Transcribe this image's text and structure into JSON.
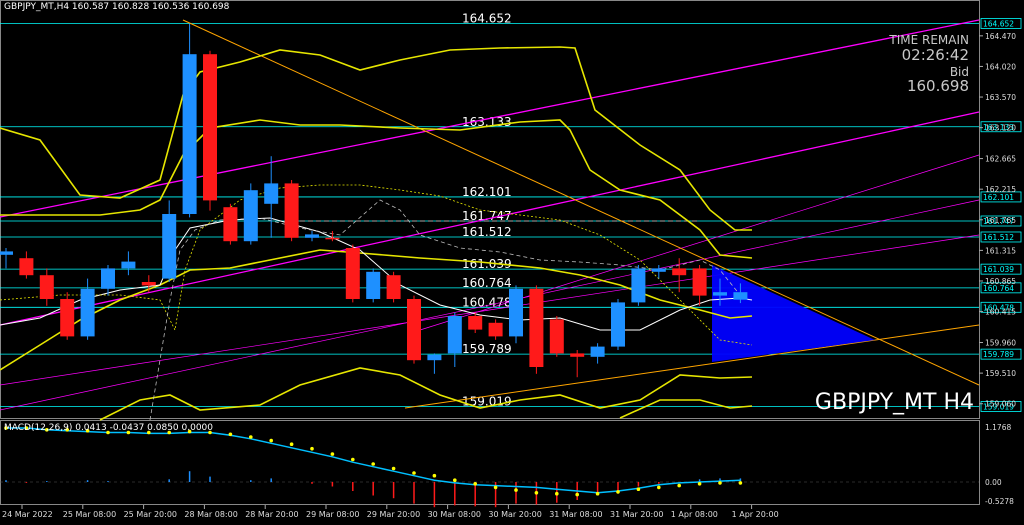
{
  "chart_header": "GBPJPY_MT,H4  160.587 160.828 160.536 160.698",
  "time_remain": {
    "label": "TIME REMAIN",
    "value": "02:26:42",
    "bid_label": "Bid",
    "bid_value": "160.698"
  },
  "symbol_label": "GBPJPY_MT H4",
  "macd_header": "MACD(12,26,9) 0.0413 -0.0437 0.0850 0.0000",
  "colors": {
    "bull": "#1e90ff",
    "bear": "#ff1a1a",
    "bands": "#e6e600",
    "trend": "#ffa500",
    "channel": "#ff00ff",
    "level": "#00ffff",
    "signal": "#ffff00",
    "macd_line": "#00bfff",
    "triangle": "#0000ff"
  },
  "chart_data": {
    "type": "candlestick",
    "price_axis_ticks": [
      "164.470",
      "164.020",
      "163.570",
      "163.120",
      "162.665",
      "162.215",
      "161.765",
      "161.315",
      "160.865",
      "160.415",
      "159.960",
      "159.510",
      "159.060"
    ],
    "price_tags": [
      "164.652",
      "163.133",
      "162.101",
      "161.747",
      "161.512",
      "161.039",
      "160.764",
      "160.478",
      "159.789",
      "159.019"
    ],
    "level_labels": [
      "164.652",
      "163.133",
      "162.101",
      "161.747",
      "161.512",
      "161.039",
      "160.764",
      "160.478",
      "159.789",
      "159.019"
    ],
    "time_labels": [
      "24 Mar 2022",
      "25 Mar 08:00",
      "25 Mar 20:00",
      "28 Mar 08:00",
      "28 Mar 20:00",
      "29 Mar 08:00",
      "29 Mar 20:00",
      "30 Mar 08:00",
      "30 Mar 20:00",
      "31 Mar 08:00",
      "31 Mar 20:00",
      "1 Apr 08:00",
      "1 Apr 20:00"
    ],
    "macd_axis_ticks": [
      "1.1768",
      "0.00",
      "-0.5278"
    ],
    "candles": [
      {
        "o": 161.25,
        "h": 161.35,
        "l": 161.05,
        "c": 161.3
      },
      {
        "o": 161.2,
        "h": 161.3,
        "l": 160.9,
        "c": 160.95
      },
      {
        "o": 160.95,
        "h": 161.05,
        "l": 160.5,
        "c": 160.6
      },
      {
        "o": 160.6,
        "h": 160.7,
        "l": 160.0,
        "c": 160.05
      },
      {
        "o": 160.05,
        "h": 160.9,
        "l": 160.0,
        "c": 160.75
      },
      {
        "o": 160.75,
        "h": 161.1,
        "l": 160.65,
        "c": 161.05
      },
      {
        "o": 161.05,
        "h": 161.3,
        "l": 160.95,
        "c": 161.15
      },
      {
        "o": 160.85,
        "h": 160.95,
        "l": 160.7,
        "c": 160.8
      },
      {
        "o": 160.9,
        "h": 162.05,
        "l": 160.85,
        "c": 161.85
      },
      {
        "o": 161.85,
        "h": 164.65,
        "l": 161.8,
        "c": 164.2
      },
      {
        "o": 164.2,
        "h": 164.25,
        "l": 161.9,
        "c": 162.05
      },
      {
        "o": 161.95,
        "h": 162.0,
        "l": 161.4,
        "c": 161.45
      },
      {
        "o": 161.45,
        "h": 162.3,
        "l": 161.4,
        "c": 162.2
      },
      {
        "o": 162.0,
        "h": 162.7,
        "l": 161.5,
        "c": 162.3
      },
      {
        "o": 162.3,
        "h": 162.35,
        "l": 161.45,
        "c": 161.5
      },
      {
        "o": 161.5,
        "h": 161.6,
        "l": 161.45,
        "c": 161.55
      },
      {
        "o": 161.5,
        "h": 161.6,
        "l": 161.45,
        "c": 161.48
      },
      {
        "o": 161.35,
        "h": 161.4,
        "l": 160.55,
        "c": 160.6
      },
      {
        "o": 160.6,
        "h": 161.05,
        "l": 160.55,
        "c": 161.0
      },
      {
        "o": 160.95,
        "h": 161.0,
        "l": 160.55,
        "c": 160.6
      },
      {
        "o": 160.6,
        "h": 160.65,
        "l": 159.65,
        "c": 159.7
      },
      {
        "o": 159.7,
        "h": 159.8,
        "l": 159.5,
        "c": 159.78
      },
      {
        "o": 159.8,
        "h": 160.4,
        "l": 159.6,
        "c": 160.35
      },
      {
        "o": 160.35,
        "h": 160.4,
        "l": 160.1,
        "c": 160.15
      },
      {
        "o": 160.25,
        "h": 160.3,
        "l": 160.0,
        "c": 160.05
      },
      {
        "o": 160.05,
        "h": 160.8,
        "l": 159.95,
        "c": 160.75
      },
      {
        "o": 160.75,
        "h": 160.8,
        "l": 159.5,
        "c": 159.6
      },
      {
        "o": 160.3,
        "h": 160.35,
        "l": 159.75,
        "c": 159.8
      },
      {
        "o": 159.8,
        "h": 159.85,
        "l": 159.45,
        "c": 159.75
      },
      {
        "o": 159.75,
        "h": 159.95,
        "l": 159.65,
        "c": 159.9
      },
      {
        "o": 159.9,
        "h": 160.6,
        "l": 159.85,
        "c": 160.55
      },
      {
        "o": 160.55,
        "h": 161.1,
        "l": 160.5,
        "c": 161.05
      },
      {
        "o": 161.0,
        "h": 161.1,
        "l": 160.9,
        "c": 161.05
      },
      {
        "o": 161.05,
        "h": 161.2,
        "l": 160.7,
        "c": 160.95
      },
      {
        "o": 161.05,
        "h": 161.1,
        "l": 160.5,
        "c": 160.65
      },
      {
        "o": 160.65,
        "h": 160.9,
        "l": 160.5,
        "c": 160.7
      },
      {
        "o": 160.59,
        "h": 160.83,
        "l": 160.54,
        "c": 160.7
      }
    ],
    "macd": {
      "histogram": [
        0.02,
        -0.01,
        0.01,
        0.0,
        0.02,
        0.01,
        0.0,
        0.0,
        0.03,
        0.12,
        0.06,
        0.0,
        0.02,
        0.04,
        0.0,
        -0.02,
        -0.05,
        -0.1,
        -0.15,
        -0.18,
        -0.24,
        -0.28,
        -0.26,
        -0.27,
        -0.28,
        -0.24,
        -0.25,
        -0.23,
        -0.2,
        -0.14,
        -0.1,
        -0.05,
        -0.02,
        0.0,
        0.03,
        0.04,
        0.04
      ],
      "signal": [
        0.6,
        0.6,
        0.58,
        0.58,
        0.57,
        0.55,
        0.55,
        0.55,
        0.55,
        0.56,
        0.55,
        0.53,
        0.5,
        0.46,
        0.42,
        0.37,
        0.31,
        0.25,
        0.2,
        0.15,
        0.1,
        0.07,
        0.02,
        -0.02,
        -0.06,
        -0.09,
        -0.12,
        -0.13,
        -0.14,
        -0.13,
        -0.11,
        -0.08,
        -0.06,
        -0.04,
        -0.02,
        -0.01,
        -0.01
      ],
      "line": [
        0.6,
        0.6,
        0.58,
        0.57,
        0.56,
        0.55,
        0.55,
        0.54,
        0.54,
        0.55,
        0.55,
        0.52,
        0.48,
        0.43,
        0.38,
        0.33,
        0.28,
        0.22,
        0.17,
        0.12,
        0.07,
        0.02,
        -0.01,
        -0.03,
        -0.04,
        -0.05,
        -0.06,
        -0.08,
        -0.1,
        -0.12,
        -0.1,
        -0.07,
        -0.03,
        -0.01,
        0.0,
        0.01,
        0.02
      ]
    }
  }
}
